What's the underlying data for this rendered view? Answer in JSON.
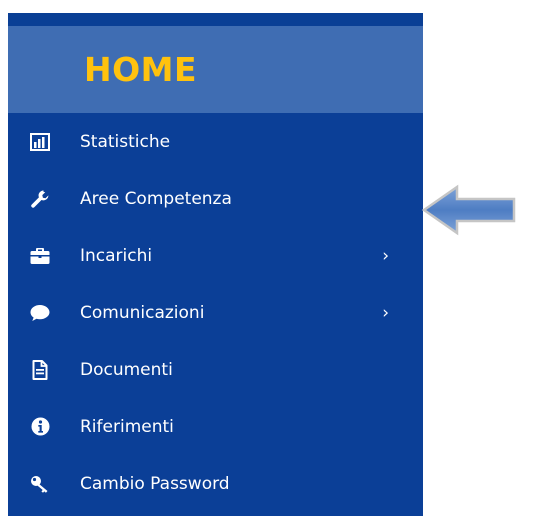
{
  "header": {
    "title": "HOME"
  },
  "menu": {
    "items": [
      {
        "label": "Statistiche",
        "icon": "bar-chart-icon",
        "has_submenu": false
      },
      {
        "label": "Aree Competenza",
        "icon": "wrench-icon",
        "has_submenu": false
      },
      {
        "label": "Incarichi",
        "icon": "briefcase-icon",
        "has_submenu": true,
        "chevron": "›"
      },
      {
        "label": "Comunicazioni",
        "icon": "chat-bubble-icon",
        "has_submenu": true,
        "chevron": "›"
      },
      {
        "label": "Documenti",
        "icon": "document-icon",
        "has_submenu": false
      },
      {
        "label": "Riferimenti",
        "icon": "info-icon",
        "has_submenu": false
      },
      {
        "label": "Cambio Password",
        "icon": "key-icon",
        "has_submenu": false
      }
    ]
  },
  "annotation": {
    "icon": "left-arrow-icon",
    "points_to": "Aree Competenza"
  },
  "colors": {
    "sidebar_bg": "#0b3f97",
    "header_bg": "#3f6db3",
    "title": "#ffc20e",
    "text": "#ffffff",
    "arrow_fill": "#5a86c9"
  }
}
